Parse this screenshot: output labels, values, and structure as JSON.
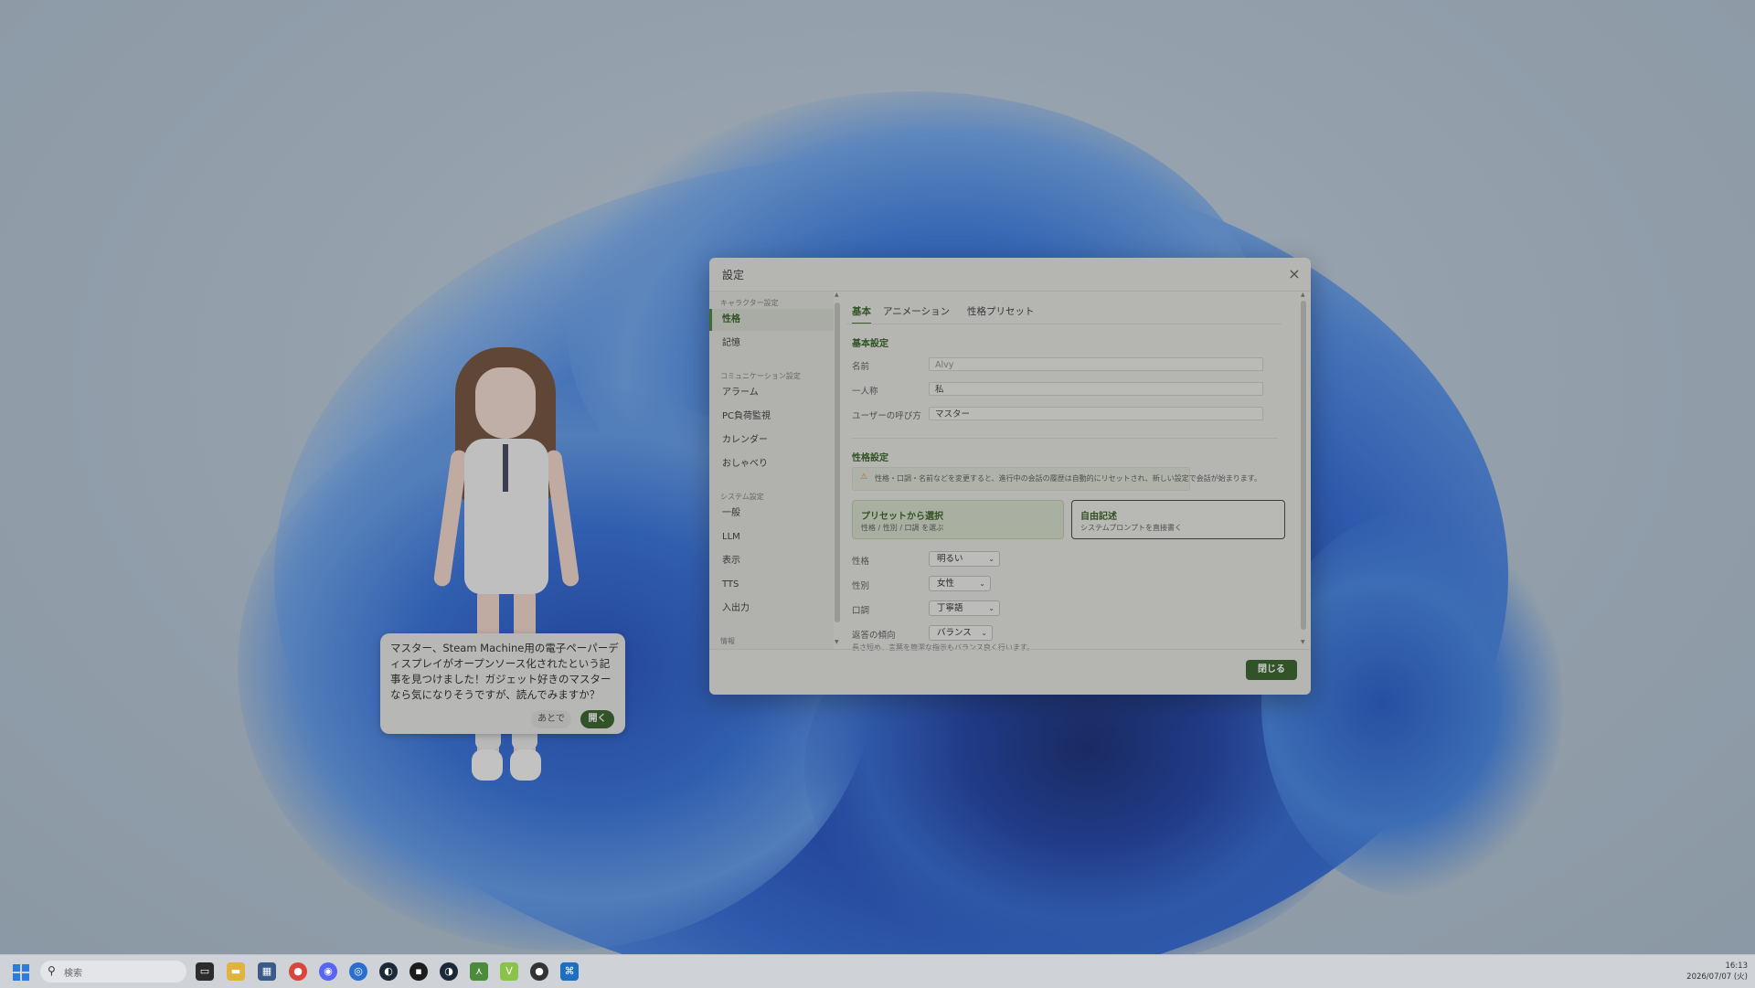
{
  "bubble": {
    "message": "マスター、Steam Machine用の電子ペーパーディスプレイがオープンソース化されたという記事を見つけました！ガジェット好きのマスターなら気になりそうですが、読んでみますか？",
    "later_label": "あとで",
    "open_label": "開く"
  },
  "dialog": {
    "title": "設定",
    "close_icon": "×",
    "sidebar": {
      "sections": {
        "character": "キャラクター設定",
        "communication": "コミュニケーション設定",
        "system": "システム設定",
        "info": "情報"
      },
      "items": {
        "personality": "性格",
        "memory": "記憶",
        "alarm": "アラーム",
        "pc_monitor": "PC負荷監視",
        "calendar": "カレンダー",
        "chat": "おしゃべり",
        "general": "一般",
        "llm": "LLM",
        "display": "表示",
        "tts": "TTS",
        "io": "入出力"
      }
    },
    "tabs": {
      "basic": "基本",
      "animation": "アニメーション",
      "preset": "性格プリセット"
    },
    "basic": {
      "section_title": "基本設定",
      "name_label": "名前",
      "name_value": "Alvy",
      "first_person_label": "一人称",
      "first_person_value": "私",
      "user_call_label": "ユーザーの呼び方",
      "user_call_value": "マスター"
    },
    "personality": {
      "section_title": "性格設定",
      "notice": "性格・口調・名前などを変更すると、進行中の会話の履歴は自動的にリセットされ、新しい設定で会話が始まります。",
      "preset_title": "プリセットから選択",
      "preset_sub": "性格 / 性別 / 口調 を選ぶ",
      "free_title": "自由記述",
      "free_sub": "システムプロンプトを直接書く",
      "trait_label": "性格",
      "trait_value": "明るい",
      "gender_label": "性別",
      "gender_value": "女性",
      "tone_label": "口調",
      "tone_value": "丁寧語",
      "tendency_label": "返答の傾向",
      "tendency_value": "バランス",
      "hint": "長さ短め、言葉を簡潔な指示もバランス良く行います。"
    },
    "close_button": "閉じる"
  },
  "taskbar": {
    "search_placeholder": "検索",
    "time": "16:13",
    "date": "2026/07/07 (火)"
  }
}
